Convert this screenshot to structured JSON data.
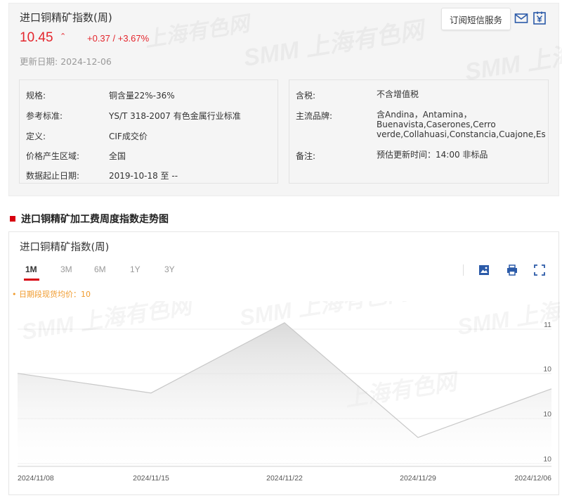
{
  "header": {
    "title": "进口铜精矿指数(周)",
    "price": "10.45",
    "change": "+0.37 / +3.67%",
    "date_label": "更新日期:",
    "date_value": "2024-12-06",
    "subscribe_label": "订阅短信服务"
  },
  "watermark": {
    "brand": "SMM",
    "cn": "上海有色网"
  },
  "info_left": [
    {
      "label": "规格:",
      "value": "铜含量22%-36%"
    },
    {
      "label": "参考标准:",
      "value": "YS/T 318-2007 有色金属行业标准"
    },
    {
      "label": "定义:",
      "value": "CIF成交价"
    },
    {
      "label": "价格产生区域:",
      "value": "全国"
    },
    {
      "label": "数据起止日期:",
      "value": "2019-10-18 至 --"
    }
  ],
  "info_right": [
    {
      "label": "含税:",
      "value": "不含增值税"
    },
    {
      "label": "主流品牌:",
      "value": "含Andina，Antamina，Buenavista,Caserones,Cerro verde,Collahuasi,Constancia,Cuajone,Escondida,Las Bambas,Mantoverde,Quebrada Blanca,Sentinel,Toquepala..."
    },
    {
      "label": "备注:",
      "value": "预估更新时间：14:00 非标品"
    }
  ],
  "section_title": "进口铜精矿加工费周度指数走势图",
  "chart_panel": {
    "title": "进口铜精矿指数(周)",
    "tabs": [
      "1M",
      "3M",
      "6M",
      "1Y",
      "3Y"
    ],
    "active_tab": "1M",
    "legend_note": "• 日期段现货均价：10"
  },
  "colors": {
    "accent_red": "#d7000f",
    "price_red": "#e4262d",
    "legend_orange": "#f09a2c",
    "line": "#cccccc"
  },
  "chart_data": {
    "type": "area",
    "x": [
      "2024/11/08",
      "2024/11/15",
      "2024/11/22",
      "2024/11/29",
      "2024/12/06"
    ],
    "y": [
      10.6,
      10.41,
      11.09,
      9.98,
      10.45
    ],
    "y_tick_labels": [
      "11",
      "10",
      "10",
      "10"
    ],
    "ylim": [
      9.7,
      11.3
    ],
    "grid": true,
    "title": "",
    "xlabel": "",
    "ylabel": ""
  }
}
